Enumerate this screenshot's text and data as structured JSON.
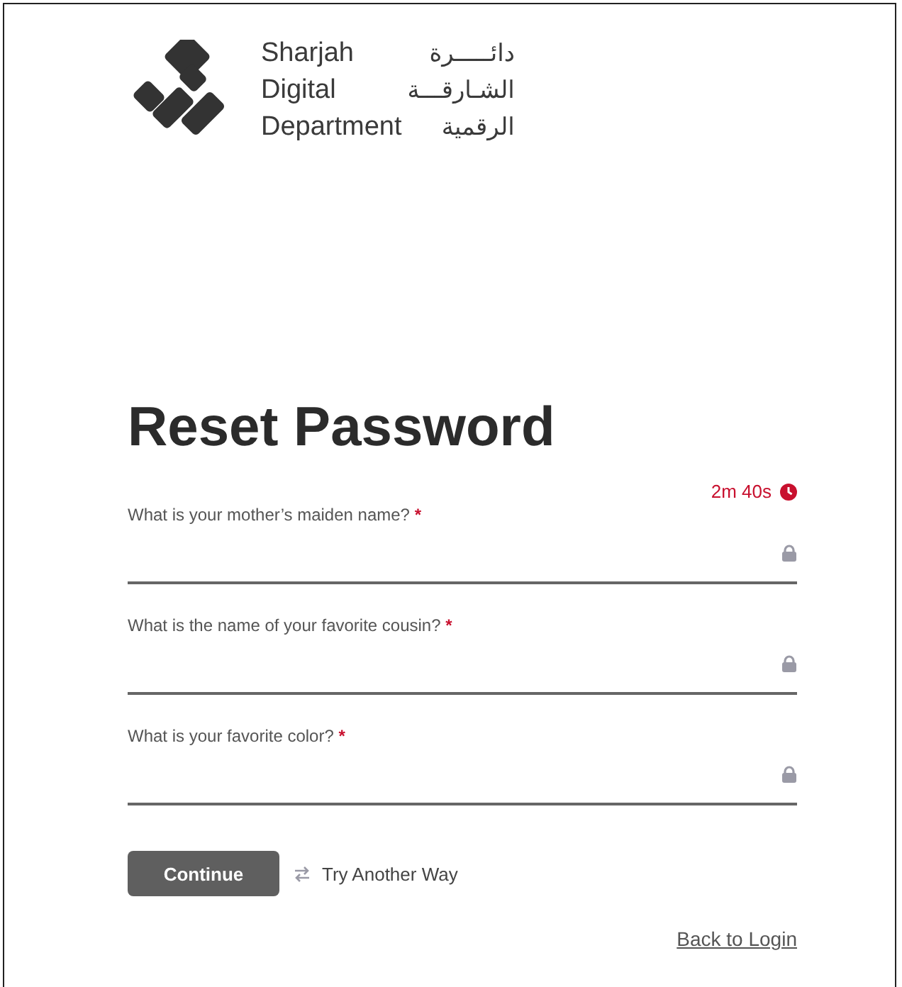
{
  "logo": {
    "english_lines": [
      "Sharjah",
      "Digital",
      "Department"
    ],
    "arabic_lines": [
      "دائـــــرة",
      "الشـارقـــة",
      "الرقمية"
    ]
  },
  "title": "Reset Password",
  "timer": {
    "text": "2m 40s"
  },
  "questions": [
    {
      "label": "What is your mother’s maiden name?",
      "required_mark": "*",
      "locked": true
    },
    {
      "label": "What is the name of your favorite cousin?",
      "required_mark": "*",
      "locked": true
    },
    {
      "label": "What is your favorite color?",
      "required_mark": "*",
      "locked": true
    }
  ],
  "continue_button": "Continue",
  "alternate_link": "Try Another Way",
  "back_link": "Back to Login"
}
